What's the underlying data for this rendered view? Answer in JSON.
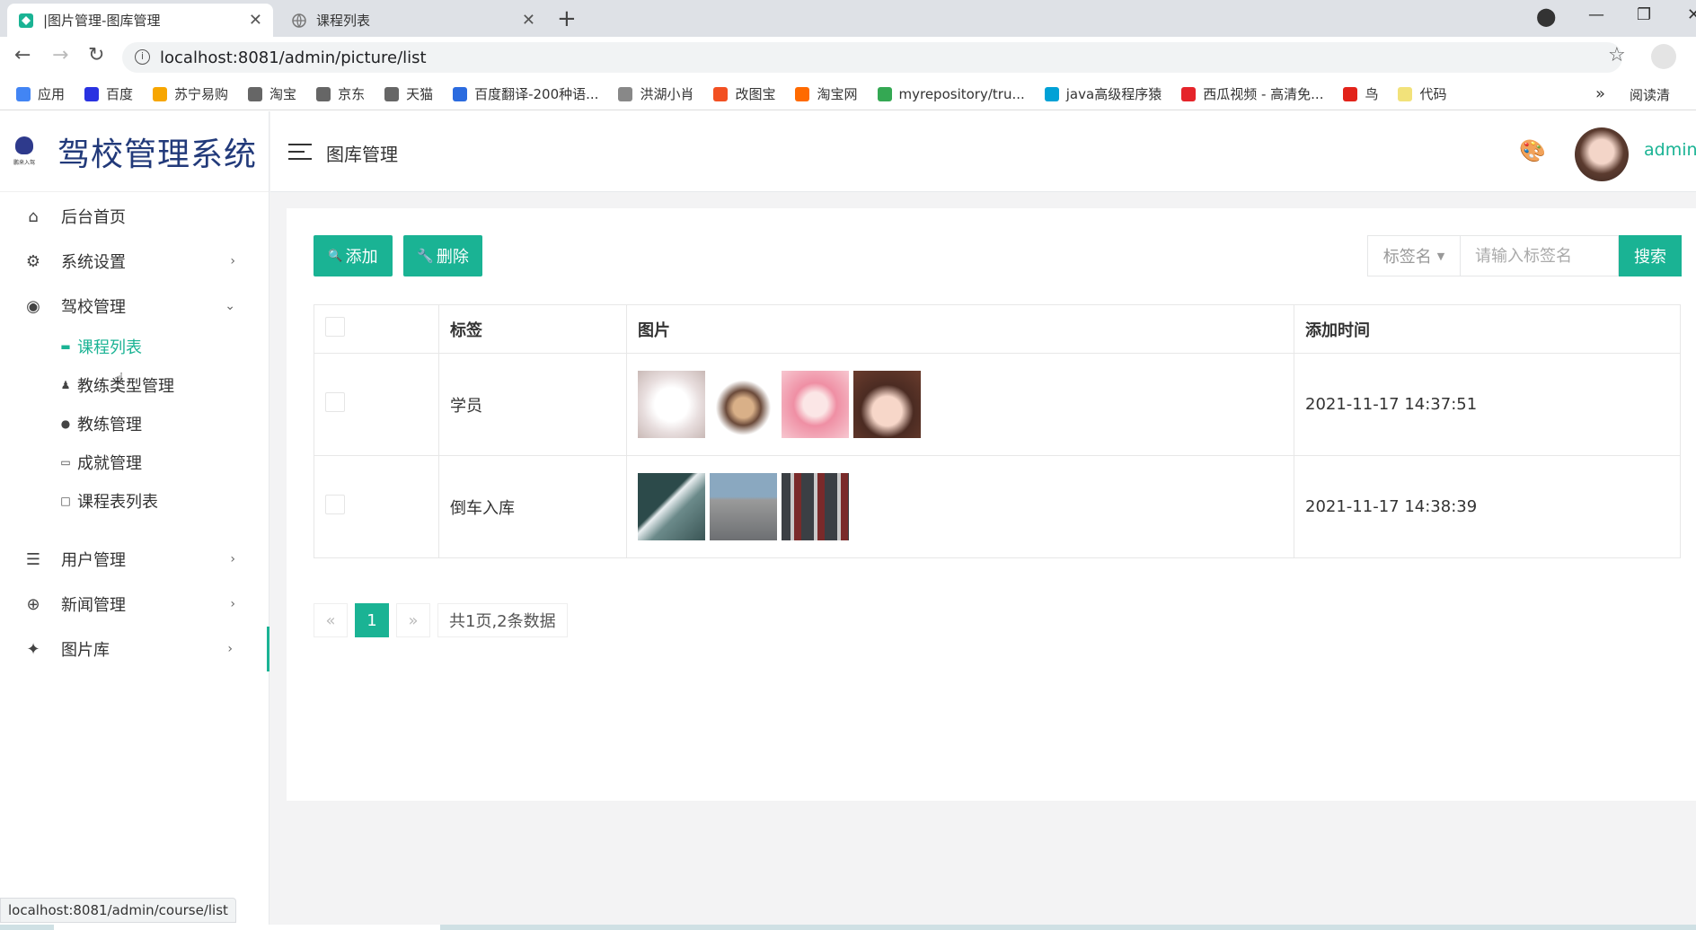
{
  "browser": {
    "tabs": [
      {
        "title": "|图片管理-图库管理",
        "active": true
      },
      {
        "title": "课程列表",
        "active": false
      }
    ],
    "url": "localhost:8081/admin/picture/list",
    "bookmarks": [
      {
        "label": "应用",
        "color": "#4285f4"
      },
      {
        "label": "百度",
        "color": "#2932e1"
      },
      {
        "label": "苏宁易购",
        "color": "#f7a600"
      },
      {
        "label": "淘宝",
        "color": "#666666"
      },
      {
        "label": "京东",
        "color": "#666666"
      },
      {
        "label": "天猫",
        "color": "#666666"
      },
      {
        "label": "百度翻译-200种语...",
        "color": "#2b6bdf"
      },
      {
        "label": "洪湖小肖",
        "color": "#888888"
      },
      {
        "label": "改图宝",
        "color": "#f25022"
      },
      {
        "label": "淘宝网",
        "color": "#ff6a00"
      },
      {
        "label": "myrepository/tru...",
        "color": "#34a853"
      },
      {
        "label": "java高级程序猿",
        "color": "#00a1d6"
      },
      {
        "label": "西瓜视频 - 高清免...",
        "color": "#e5242a"
      },
      {
        "label": "鸟",
        "color": "#e2231a"
      },
      {
        "label": "代码",
        "color": "#f2e27a"
      }
    ],
    "bookmarks_more": "»",
    "reading_list": "阅读清",
    "status_url": "localhost:8081/admin/course/list"
  },
  "app": {
    "title": "驾校管理系统",
    "logo_text": "鹏来入驾",
    "breadcrumb": "图库管理",
    "user": "admin"
  },
  "sidebar": {
    "items": [
      {
        "label": "后台首页",
        "icon": "home-icon",
        "glyph": "⌂",
        "chevron": ""
      },
      {
        "label": "系统设置",
        "icon": "gear-icon",
        "glyph": "⚙",
        "chevron": "›"
      },
      {
        "label": "驾校管理",
        "icon": "steering-wheel-icon",
        "glyph": "◉",
        "chevron": "⌄"
      },
      {
        "label": "用户管理",
        "icon": "list-icon",
        "glyph": "☰",
        "chevron": "›"
      },
      {
        "label": "新闻管理",
        "icon": "arrow-up-circle-icon",
        "glyph": "⊕",
        "chevron": "›"
      },
      {
        "label": "图片库",
        "icon": "sparkle-icon",
        "glyph": "✦",
        "chevron": "›"
      }
    ],
    "subitems": [
      {
        "label": "课程列表",
        "icon": "card-icon",
        "glyph": "▬"
      },
      {
        "label": "教练类型管理",
        "icon": "person-icon",
        "glyph": "♟"
      },
      {
        "label": "教练管理",
        "icon": "user-icon",
        "glyph": "●"
      },
      {
        "label": "成就管理",
        "icon": "keyboard-icon",
        "glyph": "▭"
      },
      {
        "label": "课程表列表",
        "icon": "window-icon",
        "glyph": "□"
      }
    ]
  },
  "toolbar": {
    "add_label": "添加",
    "delete_label": "删除",
    "tag_select": "标签名",
    "search_placeholder": "请输入标签名",
    "search_label": "搜索"
  },
  "table": {
    "headers": [
      "",
      "标签",
      "图片",
      "添加时间"
    ],
    "rows": [
      {
        "tag": "学员",
        "time": "2021-11-17 14:37:51",
        "images": 4
      },
      {
        "tag": "倒车入库",
        "time": "2021-11-17 14:38:39",
        "images": 3
      }
    ]
  },
  "pagination": {
    "prev": "«",
    "current": "1",
    "next": "»",
    "summary": "共1页,2条数据"
  }
}
